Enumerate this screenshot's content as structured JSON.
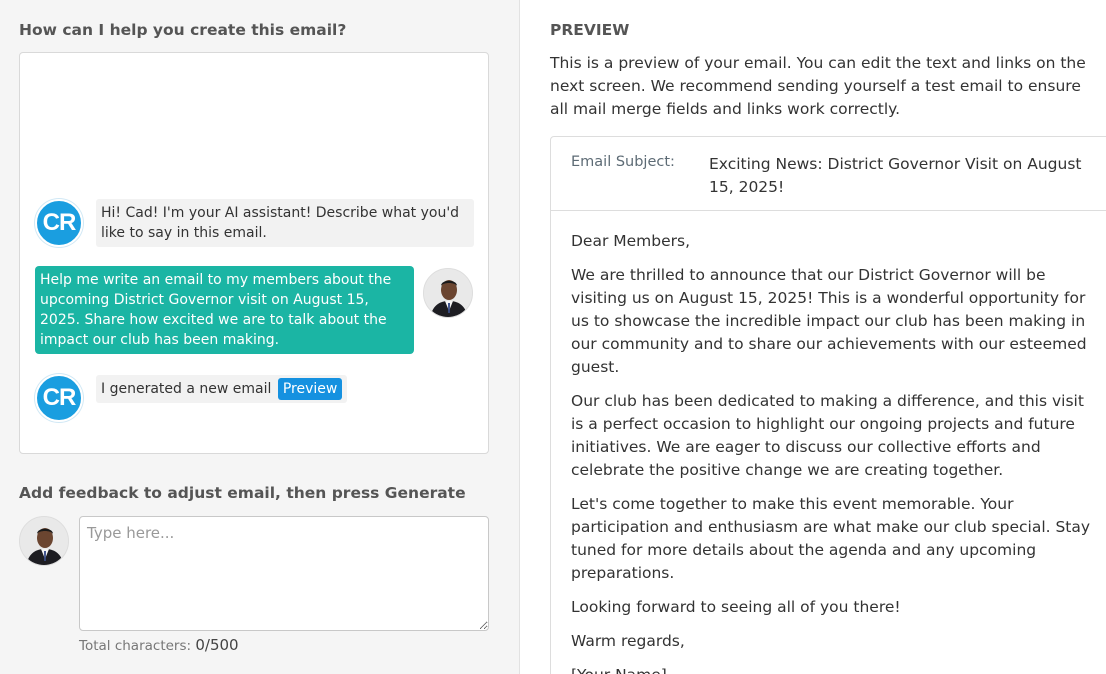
{
  "left": {
    "heading": "How can I help you create this email?",
    "assistant_avatar_text": "CR",
    "messages": [
      {
        "role": "assistant",
        "text": "Hi! Cad! I'm your AI assistant! Describe what you'd like to say in this email."
      },
      {
        "role": "user",
        "text": "Help me write an email to my members about the upcoming District Governor visit on August 15, 2025. Share how excited we are to talk about the impact our club has been making."
      },
      {
        "role": "assistant",
        "text": "I generated a new email",
        "button": "Preview"
      }
    ],
    "feedback_heading": "Add feedback to adjust email, then press Generate",
    "feedback_placeholder": "Type here...",
    "char_label": "Total characters:",
    "char_count": "0/500"
  },
  "preview": {
    "title": "PREVIEW",
    "description": "This is a preview of your email. You can edit the text and links on the next screen. We recommend sending yourself a test email to ensure all mail merge fields and links work correctly.",
    "subject_label": "Email Subject:",
    "subject_value": "Exciting News: District Governor Visit on August 15, 2025!",
    "body": [
      "Dear Members,",
      "We are thrilled to announce that our District Governor will be visiting us on August 15, 2025! This is a wonderful opportunity for us to showcase the incredible impact our club has been making in our community and to share our achievements with our esteemed guest.",
      "Our club has been dedicated to making a difference, and this visit is a perfect occasion to highlight our ongoing projects and future initiatives. We are eager to discuss our collective efforts and celebrate the positive change we are creating together.",
      "Let's come together to make this event memorable. Your participation and enthusiasm are what make our club special. Stay tuned for more details about the agenda and any upcoming preparations.",
      "Looking forward to seeing all of you there!",
      "Warm regards,",
      "[Your Name]"
    ]
  },
  "colors": {
    "assistant_avatar": "#1a9ee0",
    "user_bubble": "#1bb5a4",
    "preview_button": "#1591e0"
  }
}
